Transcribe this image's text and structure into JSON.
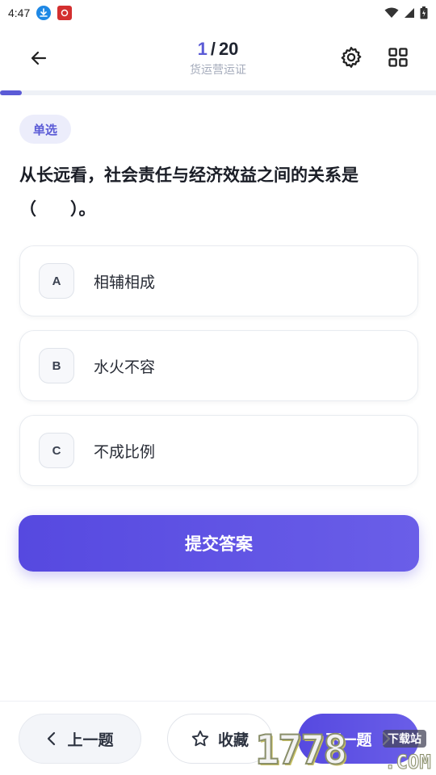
{
  "status_bar": {
    "time": "4:47"
  },
  "header": {
    "progress_current": "1",
    "progress_separator": "/",
    "progress_total": "20",
    "subtitle": "货运营运证"
  },
  "progress": {
    "fraction": 0.05
  },
  "question": {
    "type_tag": "单选",
    "text": "从长远看，社会责任与经济效益之间的关系是（　　）。",
    "options": [
      {
        "letter": "A",
        "text": "相辅相成"
      },
      {
        "letter": "B",
        "text": "水火不容"
      },
      {
        "letter": "C",
        "text": "不成比例"
      }
    ]
  },
  "actions": {
    "submit_label": "提交答案",
    "prev_label": "上一题",
    "favorite_label": "收藏",
    "next_label": "下一题"
  },
  "watermark": {
    "number": "1778",
    "tag": "下载站",
    "domain": ".COM"
  },
  "colors": {
    "accent": "#5b5bd6",
    "tag_bg": "#ecedfb"
  }
}
